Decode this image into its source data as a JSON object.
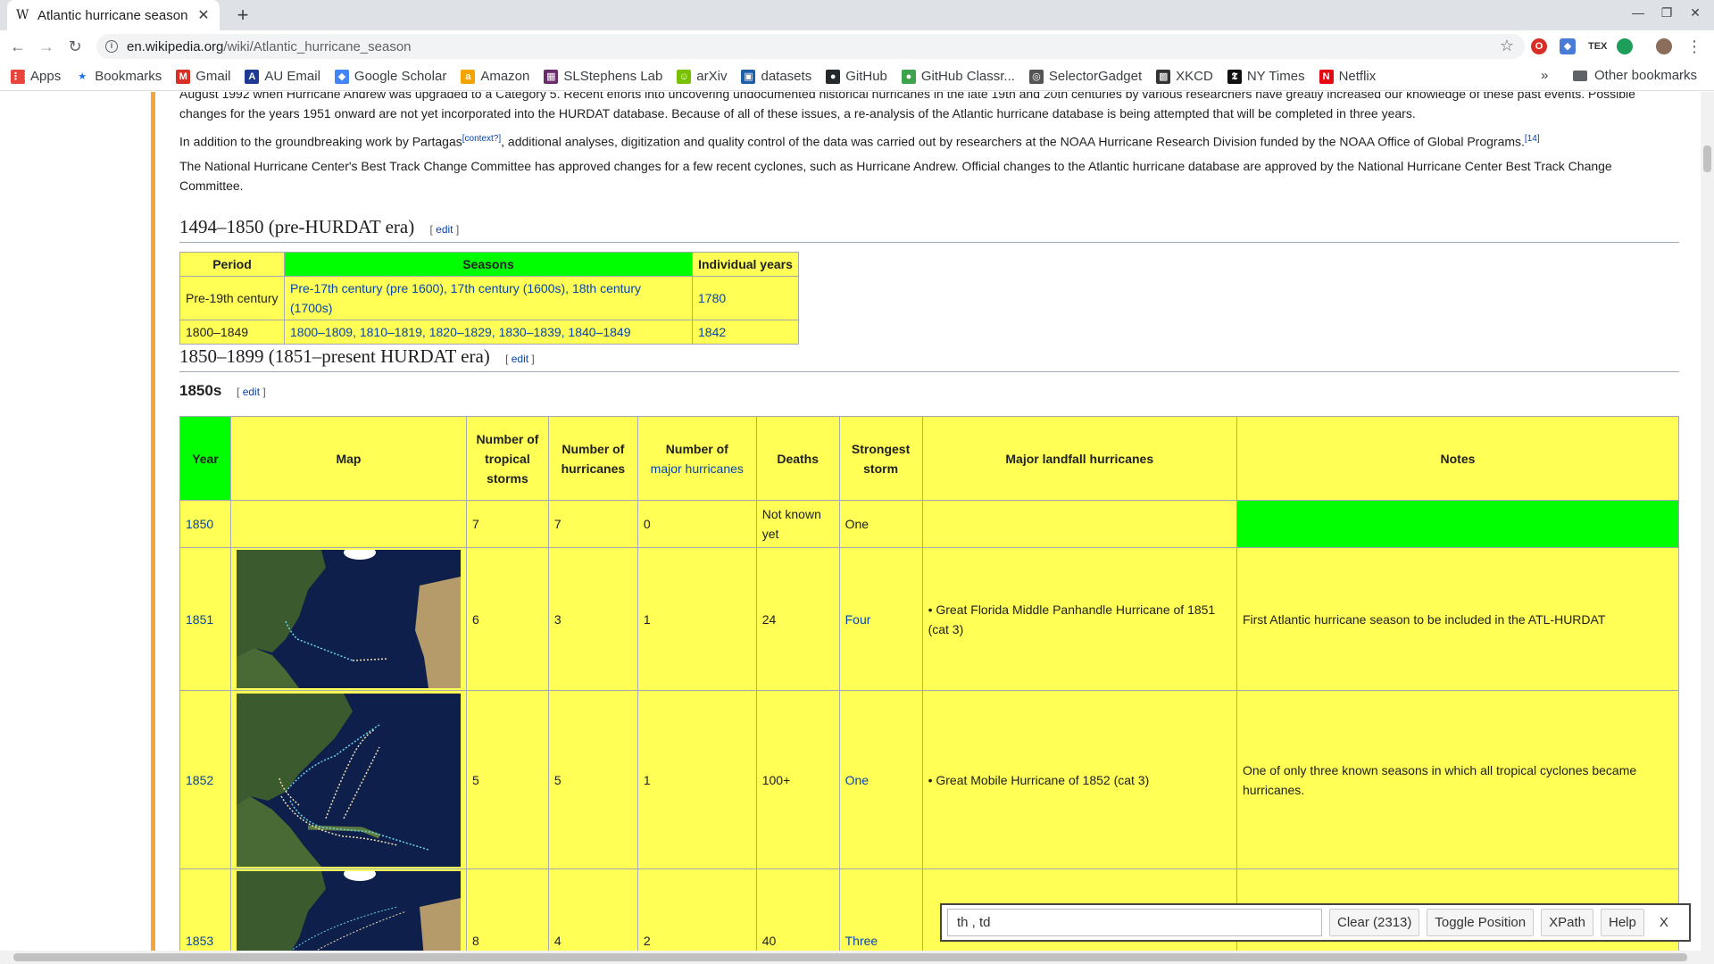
{
  "browser": {
    "tab_title": "Atlantic hurricane season",
    "tab_favicon": "W",
    "url_domain": "en.wikipedia.org",
    "url_path": "/wiki/Atlantic_hurricane_season",
    "bookmarks": [
      {
        "label": "Apps",
        "icon": "apps-grid-icon",
        "color": "#e8453c"
      },
      {
        "label": "Bookmarks",
        "icon": "star-icon",
        "color": "#1a73e8"
      },
      {
        "label": "Gmail",
        "icon": "gmail-icon",
        "color": "#d93025"
      },
      {
        "label": "AU Email",
        "icon": "au-email-icon",
        "color": "#1f3a93"
      },
      {
        "label": "Google Scholar",
        "icon": "scholar-icon",
        "color": "#4285f4"
      },
      {
        "label": "Amazon",
        "icon": "amazon-icon",
        "color": "#f4a300"
      },
      {
        "label": "SLStephens Lab",
        "icon": "lab-icon",
        "color": "#6b2c6b"
      },
      {
        "label": "arXiv",
        "icon": "arxiv-icon",
        "color": "#79c000"
      },
      {
        "label": "datasets",
        "icon": "datasets-icon",
        "color": "#1f5fa8"
      },
      {
        "label": "GitHub",
        "icon": "github-icon",
        "color": "#24292e"
      },
      {
        "label": "GitHub Classr...",
        "icon": "github-classroom-icon",
        "color": "#3fa34d"
      },
      {
        "label": "SelectorGadget",
        "icon": "selectorgadget-icon",
        "color": "#555555"
      },
      {
        "label": "XKCD",
        "icon": "xkcd-icon",
        "color": "#333333"
      },
      {
        "label": "NY Times",
        "icon": "nytimes-icon",
        "color": "#111111"
      },
      {
        "label": "Netflix",
        "icon": "netflix-icon",
        "color": "#e50914"
      }
    ],
    "bookmarks_more": "»",
    "other_bookmarks": "Other bookmarks"
  },
  "article": {
    "para1": "August 1992 when Hurricane Andrew was upgraded to a Category 5. Recent efforts into uncovering undocumented historical hurricanes in the late 19th and 20th centuries by various researchers have greatly increased our knowledge of these past events. Possible changes for the years 1951 onward are not yet incorporated into the HURDAT database. Because of all of these issues, a re-analysis of the Atlantic hurricane database is being attempted that will be completed in three years.",
    "para2_a": "In addition to the groundbreaking work by Partagas",
    "para2_sup1": "[context?]",
    "para2_b": ", additional analyses, digitization and quality control of the data was carried out by researchers at the NOAA Hurricane Research Division funded by the NOAA Office of Global Programs.",
    "para2_sup2": "[14]",
    "para3": "The National Hurricane Center's Best Track Change Committee has approved changes for a few recent cyclones, such as Hurricane Andrew. Official changes to the Atlantic hurricane database are approved by the National Hurricane Center Best Track Change Committee.",
    "heading1": "1494–1850 (pre-HURDAT era)",
    "heading2": "1850–1899 (1851–present HURDAT era)",
    "heading3": "1850s",
    "edit_open": "[ ",
    "edit_label": "edit",
    "edit_close": " ]"
  },
  "pre_table": {
    "headers": [
      "Period",
      "Seasons",
      "Individual years"
    ],
    "rows": [
      {
        "period": "Pre-19th century",
        "seasons": "Pre-17th century (pre 1600), 17th century (1600s), 18th century (1700s)",
        "years": "1780"
      },
      {
        "period": "1800–1849",
        "seasons": "1800–1809, 1810–1819, 1820–1829, 1830–1839, 1840–1849",
        "years": "1842"
      }
    ]
  },
  "main_table": {
    "headers": {
      "year": "Year",
      "map": "Map",
      "tropical_storms": "Number of tropical storms",
      "hurricanes": "Number of hurricanes",
      "major_prefix": "Number of",
      "major_link": "major hurricanes",
      "deaths": "Deaths",
      "strongest": "Strongest storm",
      "landfall": "Major landfall hurricanes",
      "notes": "Notes"
    },
    "rows": [
      {
        "year": "1850",
        "ts": "7",
        "hurr": "7",
        "major": "0",
        "deaths": "Not known yet",
        "strongest": "One",
        "landfall": "",
        "notes": ""
      },
      {
        "year": "1851",
        "ts": "6",
        "hurr": "3",
        "major": "1",
        "deaths": "24",
        "strongest": "Four",
        "landfall": "• Great Florida Middle Panhandle Hurricane of 1851 (cat 3)",
        "notes": "First Atlantic hurricane season to be included in the ATL-HURDAT"
      },
      {
        "year": "1852",
        "ts": "5",
        "hurr": "5",
        "major": "1",
        "deaths": "100+",
        "strongest": "One",
        "landfall": "• Great Mobile Hurricane of 1852 (cat 3)",
        "notes": "One of only three known seasons in which all tropical cyclones became hurricanes."
      },
      {
        "year": "1853",
        "ts": "8",
        "hurr": "4",
        "major": "2",
        "deaths": "40",
        "strongest": "Three",
        "landfall": "",
        "notes": ""
      }
    ]
  },
  "selector_gadget": {
    "input_value": "th , td",
    "clear_label": "Clear (2313)",
    "toggle_label": "Toggle Position",
    "xpath_label": "XPath",
    "help_label": "Help",
    "close_label": "X"
  },
  "colors": {
    "highlight_yellow": "#ffff55",
    "highlight_green": "#00ff00",
    "wiki_link": "#0645ad"
  }
}
